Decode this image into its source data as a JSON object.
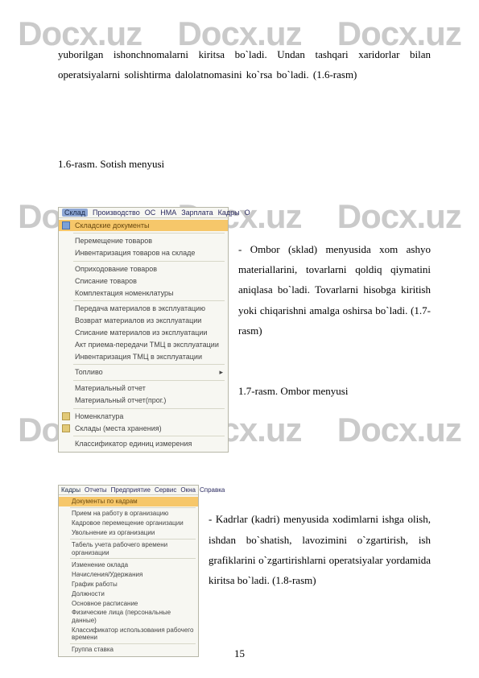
{
  "watermark": "Docx.uz",
  "para1": "yuborilgan ishonchnomalarni kiritsa bo`ladi. Undan tashqari xaridorlar bilan operatsiyalarni solishtirma dalolatnomasini ko`rsa bo`ladi. (1.6-rasm)",
  "caption1": "1.6-rasm. Sotish menyusi",
  "menu1": {
    "bar": [
      "Склад",
      "Производство",
      "ОС",
      "НМА",
      "Зарплата",
      "Кадры",
      "О"
    ],
    "items": [
      {
        "label": "Складские документы",
        "sel": true,
        "icon": "blue"
      },
      {
        "label": "Перемещение товаров",
        "sep_before": true
      },
      {
        "label": "Инвентаризация товаров на складе"
      },
      {
        "label": "Оприходование товаров",
        "sep_before": true
      },
      {
        "label": "Списание товаров"
      },
      {
        "label": "Комплектация номенклатуры"
      },
      {
        "label": "Передача материалов в эксплуатацию",
        "sep_before": true
      },
      {
        "label": "Возврат материалов из эксплуатации"
      },
      {
        "label": "Списание материалов из эксплуатации"
      },
      {
        "label": "Акт приема-передачи ТМЦ в эксплуатации"
      },
      {
        "label": "Инвентаризация ТМЦ в эксплуатации"
      },
      {
        "label": "Топливо",
        "arrow": true,
        "sep_before": true
      },
      {
        "label": "Материальный отчет",
        "sep_before": true
      },
      {
        "label": "Материальный отчет(прог.)"
      },
      {
        "label": "Номенклатура",
        "sep_before": true,
        "icon": "dot"
      },
      {
        "label": "Склады (места хранения)",
        "icon": "dot"
      },
      {
        "label": "Классификатор единиц измерения",
        "sep_before": true
      }
    ]
  },
  "para2": "- Ombor (sklad) menyusida xom ashyo materiallarini, tovarlarni qoldiq qiymatini aniqlasa bo`ladi. Tovarlarni hisobga kiritish yoki chiqarishni amalga oshirsa bo`ladi. (1.7-rasm)",
  "caption2": "1.7-rasm. Ombor menyusi",
  "menu2": {
    "bar": [
      "Кадры",
      "Отчеты",
      "Предприятие",
      "Сервис",
      "Окна",
      "Справка"
    ],
    "items": [
      {
        "label": "Документы по кадрам",
        "sel": true
      },
      {
        "label": "Прием на работу в организацию",
        "sep_before": true
      },
      {
        "label": "Кадровое перемещение организации"
      },
      {
        "label": "Увольнение из организации"
      },
      {
        "label": "Табель учета рабочего времени организации",
        "sep_before": true
      },
      {
        "label": "Изменение оклада",
        "sep_before": true
      },
      {
        "label": "Начисления/Удержания"
      },
      {
        "label": "График работы"
      },
      {
        "label": "Должности"
      },
      {
        "label": "Основное расписание"
      },
      {
        "label": "Физические лица (персональные данные)"
      },
      {
        "label": "Классификатор использования рабочего времени"
      },
      {
        "label": "Группа ставка",
        "sep_before": true
      }
    ]
  },
  "para3": "- Kadrlar (kadri) menyusida xodimlarni ishga olish, ishdan bo`shatish, lavozimini o`zgartirish, ish grafiklarini o`zgartirishlarni operatsiyalar yordamida kiritsa bo`ladi. (1.8-rasm)",
  "pagenum": "15"
}
